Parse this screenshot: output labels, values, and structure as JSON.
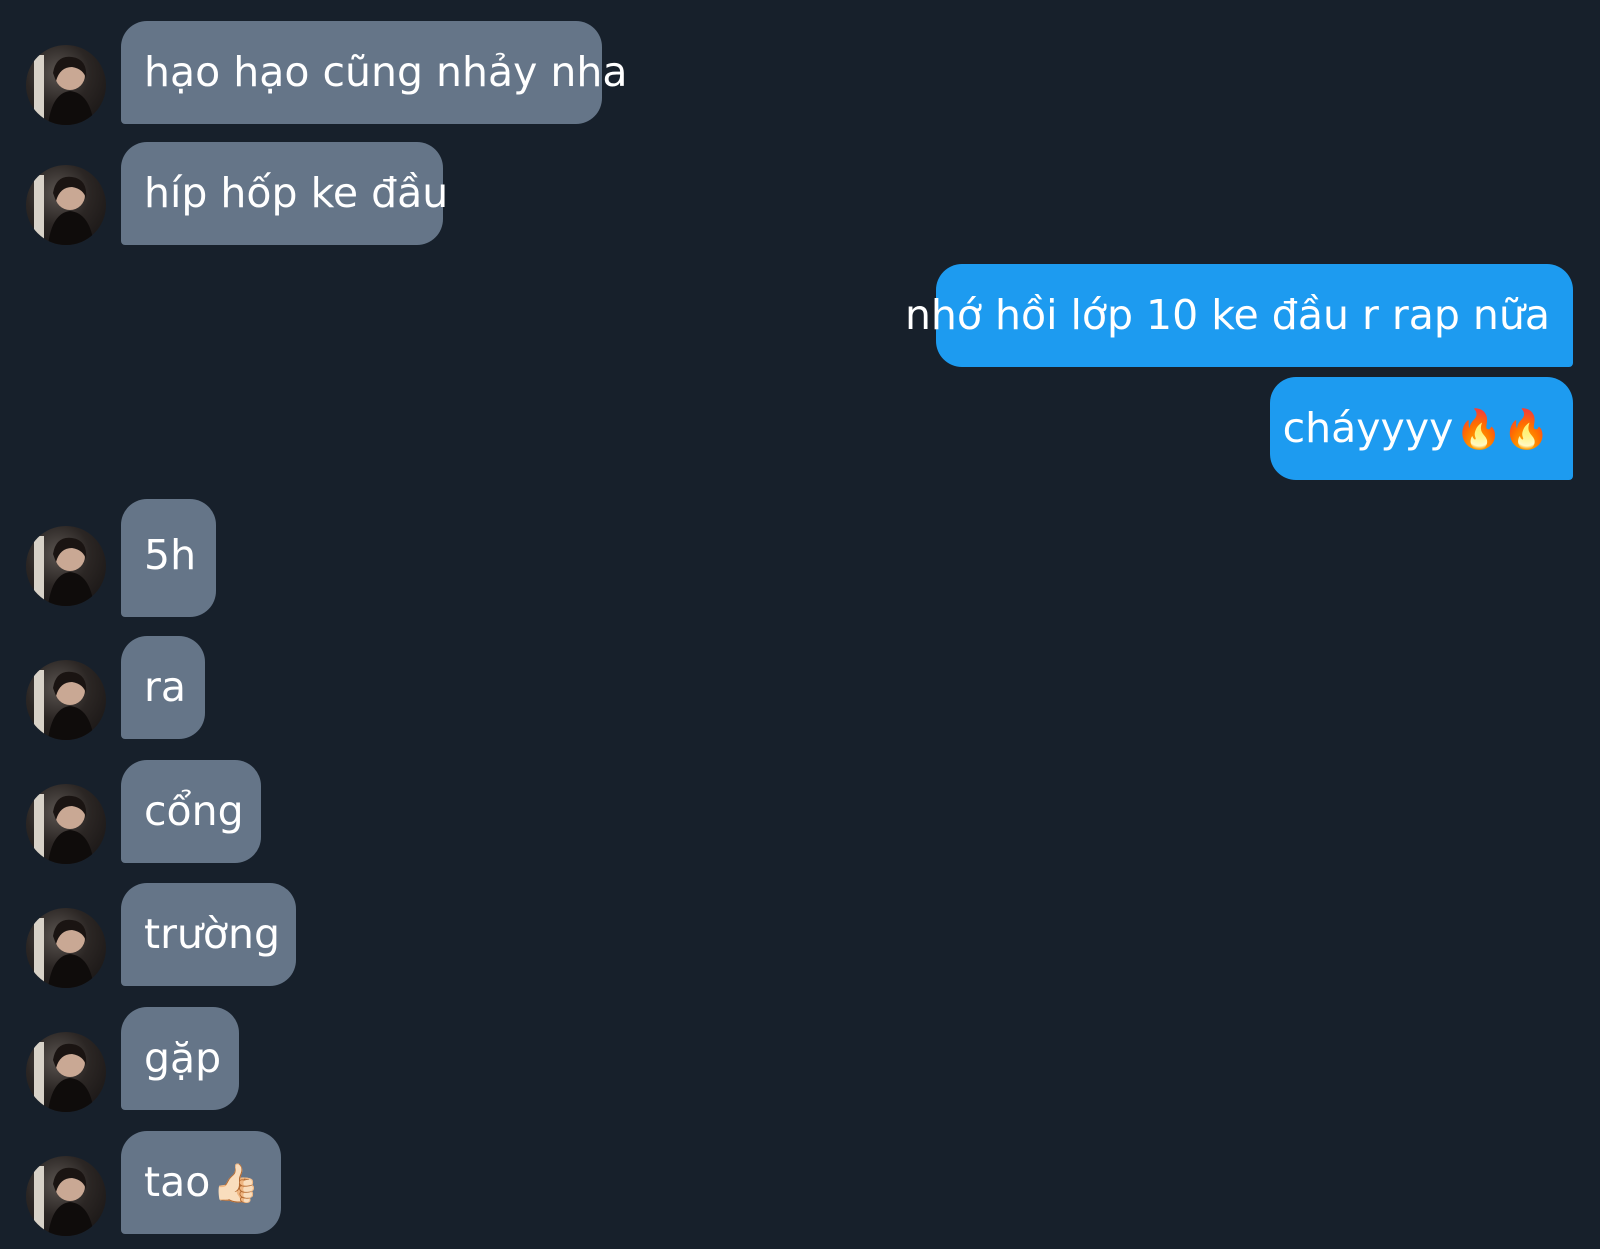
{
  "app": {
    "colors": {
      "background": "#17202b",
      "incoming_bubble": "#657588",
      "outgoing_bubble": "#1d9bf0",
      "text": "#ffffff"
    }
  },
  "messages": [
    {
      "direction": "incoming",
      "text": "hạo hạo cũng nhảy nha",
      "avatar": "contact-avatar"
    },
    {
      "direction": "incoming",
      "text": "híp hốp ke đầu",
      "avatar": "contact-avatar"
    },
    {
      "direction": "outgoing",
      "text": "nhớ hồi lớp 10 ke đầu r rap nữa"
    },
    {
      "direction": "outgoing",
      "text": "cháyyyy",
      "emoji": "🔥🔥"
    },
    {
      "direction": "incoming",
      "text": "5h",
      "avatar": "contact-avatar"
    },
    {
      "direction": "incoming",
      "text": "ra",
      "avatar": "contact-avatar"
    },
    {
      "direction": "incoming",
      "text": "cổng",
      "avatar": "contact-avatar"
    },
    {
      "direction": "incoming",
      "text": "trường",
      "avatar": "contact-avatar"
    },
    {
      "direction": "incoming",
      "text": "gặp",
      "avatar": "contact-avatar"
    },
    {
      "direction": "incoming",
      "text": "tao",
      "emoji": "👍🏻",
      "avatar": "contact-avatar"
    }
  ]
}
